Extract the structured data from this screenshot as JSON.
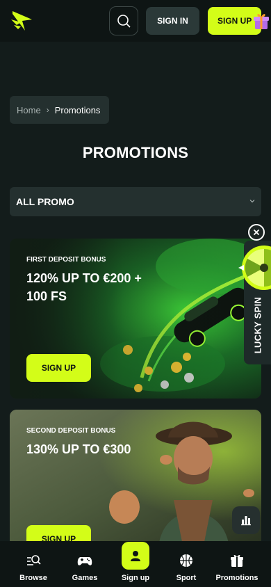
{
  "header": {
    "logo_icon": "lightning-wing-logo-icon",
    "search_icon": "search-icon",
    "signin_label": "SIGN IN",
    "signup_label": "SIGN UP",
    "gift_icon": "gift-box-icon",
    "accent_color": "#d3fd18"
  },
  "breadcrumb": {
    "home": "Home",
    "separator": "›",
    "current": "Promotions"
  },
  "page": {
    "title": "PROMOTIONS"
  },
  "filter": {
    "selected": "ALL PROMO"
  },
  "promos": [
    {
      "subtitle": "FIRST DEPOSIT BONUS",
      "title_line1": "120% UP TO €200 +",
      "title_line2": "100 FS",
      "button": "SIGN UP"
    },
    {
      "subtitle": "SECOND DEPOSIT BONUS",
      "title_line1": "130% UP TO €300",
      "button": "SIGN UP"
    }
  ],
  "lucky_spin": {
    "label": "LUCKY SPIN",
    "close_icon": "close-icon",
    "wheel_icon": "prize-wheel-icon"
  },
  "stats_icon": "bar-chart-icon",
  "bottom_nav": [
    {
      "label": "Browse",
      "icon": "browse-search-icon"
    },
    {
      "label": "Games",
      "icon": "gamepad-icon"
    },
    {
      "label": "Sign up",
      "icon": "user-icon"
    },
    {
      "label": "Sport",
      "icon": "basketball-icon"
    },
    {
      "label": "Promotions",
      "icon": "gift-icon"
    }
  ]
}
